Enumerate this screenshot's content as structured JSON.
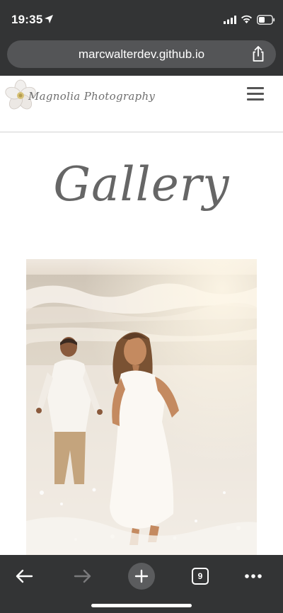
{
  "status_bar": {
    "time": "19:35",
    "icons": [
      "location-arrow-icon",
      "cellular-signal-icon",
      "wifi-icon",
      "battery-icon"
    ]
  },
  "browser": {
    "url": "marcwalterdev.github.io",
    "share_icon": "share-icon",
    "toolbar": {
      "back_icon": "back-arrow-icon",
      "forward_icon": "forward-arrow-icon",
      "new_tab_icon": "plus-icon",
      "tab_count": "9",
      "more_icon": "more-dots-icon"
    }
  },
  "site": {
    "logo_text": "Magnolia Photography",
    "menu_icon": "hamburger-menu-icon"
  },
  "page": {
    "title": "Gallery",
    "photo": "couple-on-beach-photo"
  },
  "colors": {
    "chrome_bg": "#333435",
    "url_bar_bg": "#545557",
    "title_gray": "#666666",
    "divider": "#d2d2d2"
  }
}
